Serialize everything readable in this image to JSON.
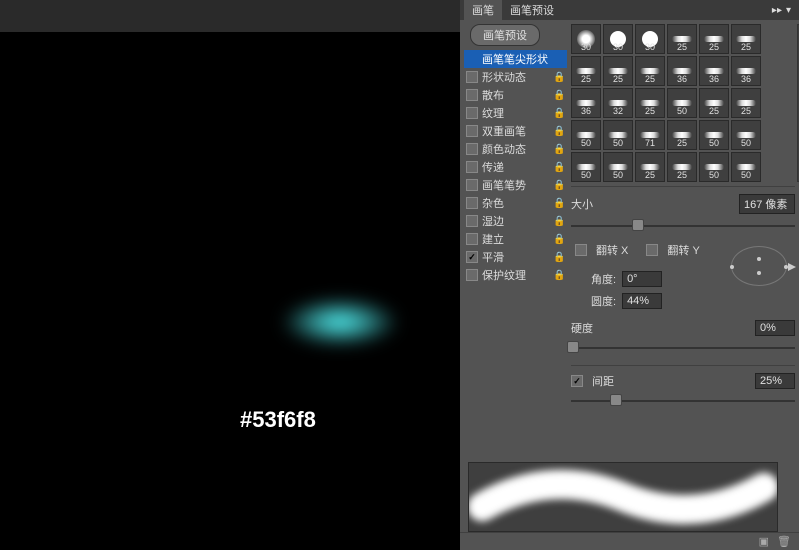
{
  "canvas": {
    "hex_label": "#53f6f8",
    "blob_color": "#53f6f8"
  },
  "panel": {
    "tabs": {
      "brush": "画笔",
      "presets": "画笔预设"
    },
    "preset_button": "画笔预设",
    "options": [
      {
        "key": "tip",
        "label": "画笔笔尖形状",
        "checked": false,
        "lock": false,
        "selected": true
      },
      {
        "key": "dynamics",
        "label": "形状动态",
        "checked": false,
        "lock": true
      },
      {
        "key": "scatter",
        "label": "散布",
        "checked": false,
        "lock": true
      },
      {
        "key": "texture",
        "label": "纹理",
        "checked": false,
        "lock": true
      },
      {
        "key": "dual",
        "label": "双重画笔",
        "checked": false,
        "lock": true
      },
      {
        "key": "color",
        "label": "颜色动态",
        "checked": false,
        "lock": true
      },
      {
        "key": "transfer",
        "label": "传递",
        "checked": false,
        "lock": true
      },
      {
        "key": "pose",
        "label": "画笔笔势",
        "checked": false,
        "lock": true
      },
      {
        "key": "noise",
        "label": "杂色",
        "checked": false,
        "lock": true
      },
      {
        "key": "wet",
        "label": "湿边",
        "checked": false,
        "lock": true
      },
      {
        "key": "buildup",
        "label": "建立",
        "checked": false,
        "lock": true
      },
      {
        "key": "smooth",
        "label": "平滑",
        "checked": true,
        "lock": true
      },
      {
        "key": "protect",
        "label": "保护纹理",
        "checked": false,
        "lock": true
      }
    ],
    "brush_grid": [
      [
        {
          "s": 30,
          "t": "soft"
        },
        {
          "s": 30,
          "t": "hard"
        },
        {
          "s": 30,
          "t": "hard"
        },
        {
          "s": 25,
          "t": "flat"
        },
        {
          "s": 25,
          "t": "flat"
        },
        {
          "s": 25,
          "t": "flat"
        }
      ],
      [
        {
          "s": 25,
          "t": "flat"
        },
        {
          "s": 25,
          "t": "flat"
        },
        {
          "s": 25,
          "t": "flat"
        },
        {
          "s": 36,
          "t": "flat"
        },
        {
          "s": 36,
          "t": "flat"
        },
        {
          "s": 36,
          "t": "flat"
        }
      ],
      [
        {
          "s": 36,
          "t": "flat"
        },
        {
          "s": 32,
          "t": "flat"
        },
        {
          "s": 25,
          "t": "flat"
        },
        {
          "s": 50,
          "t": "flat"
        },
        {
          "s": 25,
          "t": "flat"
        },
        {
          "s": 25,
          "t": "flat"
        }
      ],
      [
        {
          "s": 50,
          "t": "flat"
        },
        {
          "s": 50,
          "t": "flat"
        },
        {
          "s": 71,
          "t": "flat"
        },
        {
          "s": 25,
          "t": "flat"
        },
        {
          "s": 50,
          "t": "flat"
        },
        {
          "s": 50,
          "t": "flat"
        }
      ],
      [
        {
          "s": 50,
          "t": "flat"
        },
        {
          "s": 50,
          "t": "flat"
        },
        {
          "s": 25,
          "t": "flat"
        },
        {
          "s": 25,
          "t": "flat"
        },
        {
          "s": 50,
          "t": "flat"
        },
        {
          "s": 50,
          "t": "flat"
        }
      ]
    ],
    "size": {
      "label": "大小",
      "value": "167 像素",
      "pct": 30
    },
    "flip": {
      "x_label": "翻转 X",
      "x": false,
      "y_label": "翻转 Y",
      "y": false
    },
    "angle": {
      "label": "角度:",
      "value": "0°"
    },
    "roundness": {
      "label": "圆度:",
      "value": "44%"
    },
    "hardness": {
      "label": "硬度",
      "value": "0%",
      "pct": 1
    },
    "spacing": {
      "label": "间距",
      "checked": true,
      "value": "25%",
      "pct": 20
    }
  }
}
